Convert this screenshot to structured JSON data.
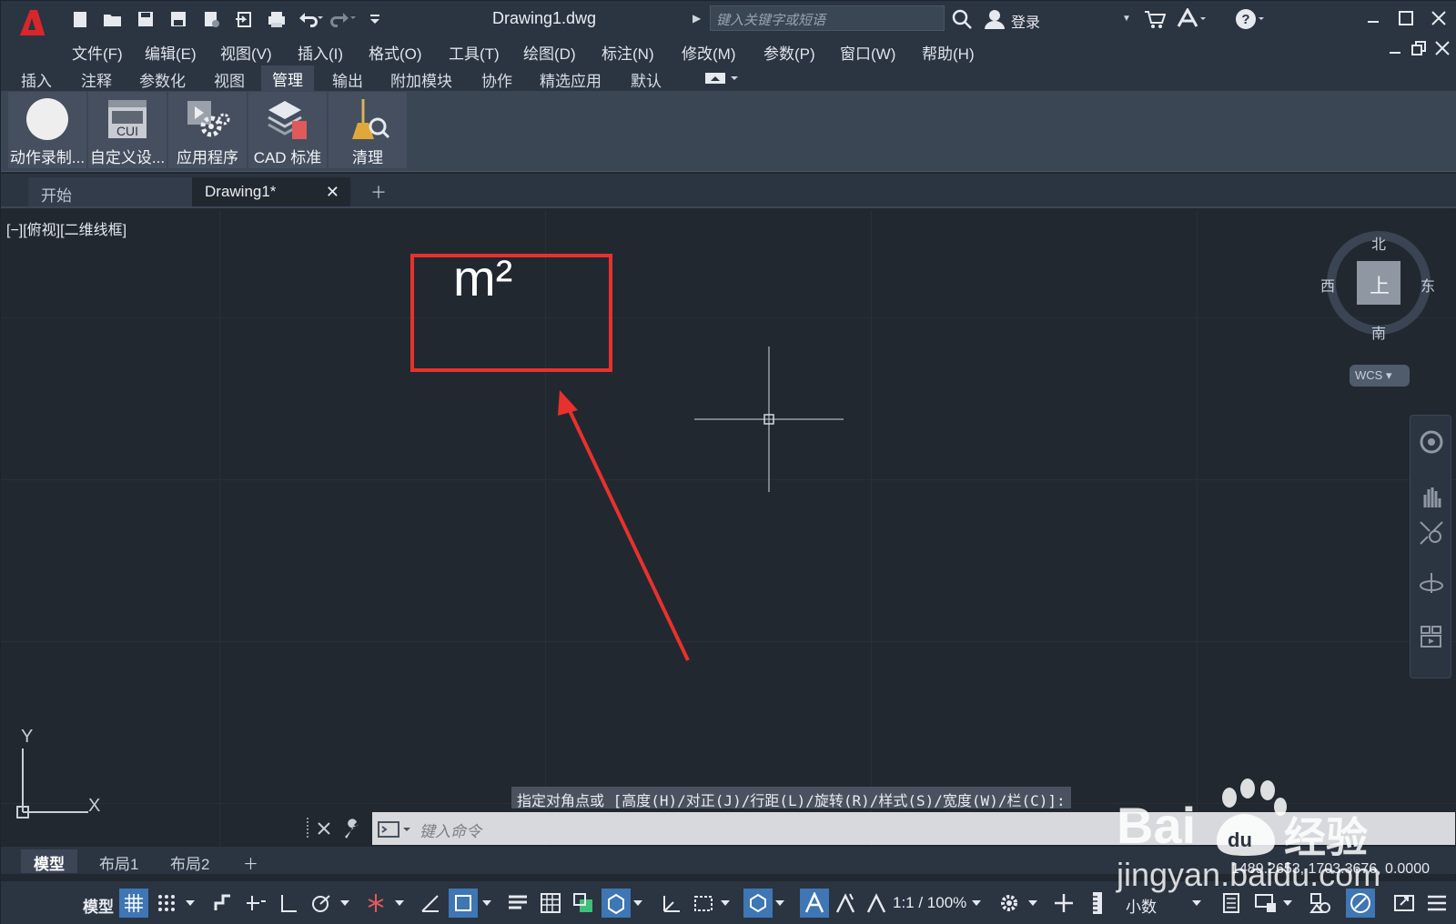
{
  "app": {
    "title": "Drawing1.dwg",
    "search_placeholder": "键入关键字或短语",
    "login": "登录"
  },
  "menu": [
    "文件(F)",
    "编辑(E)",
    "视图(V)",
    "插入(I)",
    "格式(O)",
    "工具(T)",
    "绘图(D)",
    "标注(N)",
    "修改(M)",
    "参数(P)",
    "窗口(W)",
    "帮助(H)"
  ],
  "ribbon_tabs": [
    "插入",
    "注释",
    "参数化",
    "视图",
    "管理",
    "输出",
    "附加模块",
    "协作",
    "精选应用",
    "默认"
  ],
  "ribbon_active_tab": "管理",
  "ribbon_buttons": [
    "动作录制...",
    "自定义设...",
    "应用程序",
    "CAD 标准",
    "清理"
  ],
  "cui_label": "CUI",
  "doc_tabs": {
    "start": "开始",
    "current": "Drawing1*"
  },
  "viewport": {
    "label": "[−][俯视][二维线框]",
    "mtext": "m²",
    "compass": {
      "north": "北",
      "south": "南",
      "east": "东",
      "west": "西",
      "top": "上"
    },
    "wcs": "WCS",
    "ucs_x": "X",
    "ucs_y": "Y"
  },
  "command": {
    "prompt": "指定对角点或 [高度(H)/对正(J)/行距(L)/旋转(R)/样式(S)/宽度(W)/栏(C)]:",
    "placeholder": "键入命令"
  },
  "layout_tabs": [
    "模型",
    "布局1",
    "布局2"
  ],
  "coordinates": "1489.2653, 1703.3676, 0.0000",
  "status": {
    "model": "模型",
    "scale": "1:1 / 100%",
    "units": "小数"
  },
  "watermark": {
    "brand": "经验",
    "url": "jingyan.baidu.com"
  },
  "colors": {
    "annotation_red": "#e8312d",
    "accent_blue": "#3f76b4"
  }
}
